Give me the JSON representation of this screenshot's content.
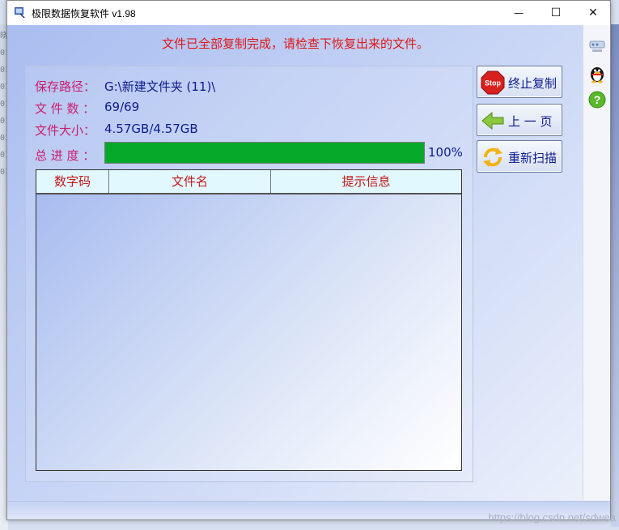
{
  "background_window": {
    "fragments": [
      "晓",
      "01",
      "01",
      "01",
      "01",
      "01",
      "01",
      "01",
      "01"
    ]
  },
  "window": {
    "title": "极限数据恢复软件 v1.98",
    "controls": {
      "minimize": "—",
      "maximize": "☐",
      "close": "✕"
    }
  },
  "message": "文件已全部复制完成，请检查下恢复出来的文件。",
  "info": {
    "path_label": "保存路径：",
    "path_value": "G:\\新建文件夹 (11)\\",
    "count_label": "文 件 数 ：",
    "count_value": "69/69",
    "size_label": "文件大小：",
    "size_value": "4.57GB/4.57GB",
    "progress_label": "总 进 度 ：",
    "progress_percent": 100,
    "progress_text": "100%"
  },
  "table": {
    "columns": [
      "数字码",
      "文件名",
      "提示信息"
    ],
    "rows": []
  },
  "buttons": {
    "stop": {
      "label": "终止复制",
      "icon": "stop-icon",
      "icon_text": "Stop"
    },
    "prev": {
      "label": "上 一 页",
      "icon": "arrow-left-icon"
    },
    "rescan": {
      "label": "重新扫描",
      "icon": "refresh-icon"
    }
  },
  "sidebar": {
    "items": [
      {
        "icon": "network-icon"
      },
      {
        "icon": "qq-penguin-icon"
      },
      {
        "icon": "help-icon",
        "glyph": "?"
      }
    ]
  },
  "watermark": "https://blog.csdn.net/sdwea",
  "colors": {
    "label": "#cc1e6e",
    "value": "#0d1c8c",
    "message": "#e01818",
    "progress": "#06a82a",
    "header_bg": "#e2f8ff",
    "header_text": "#c41717"
  }
}
